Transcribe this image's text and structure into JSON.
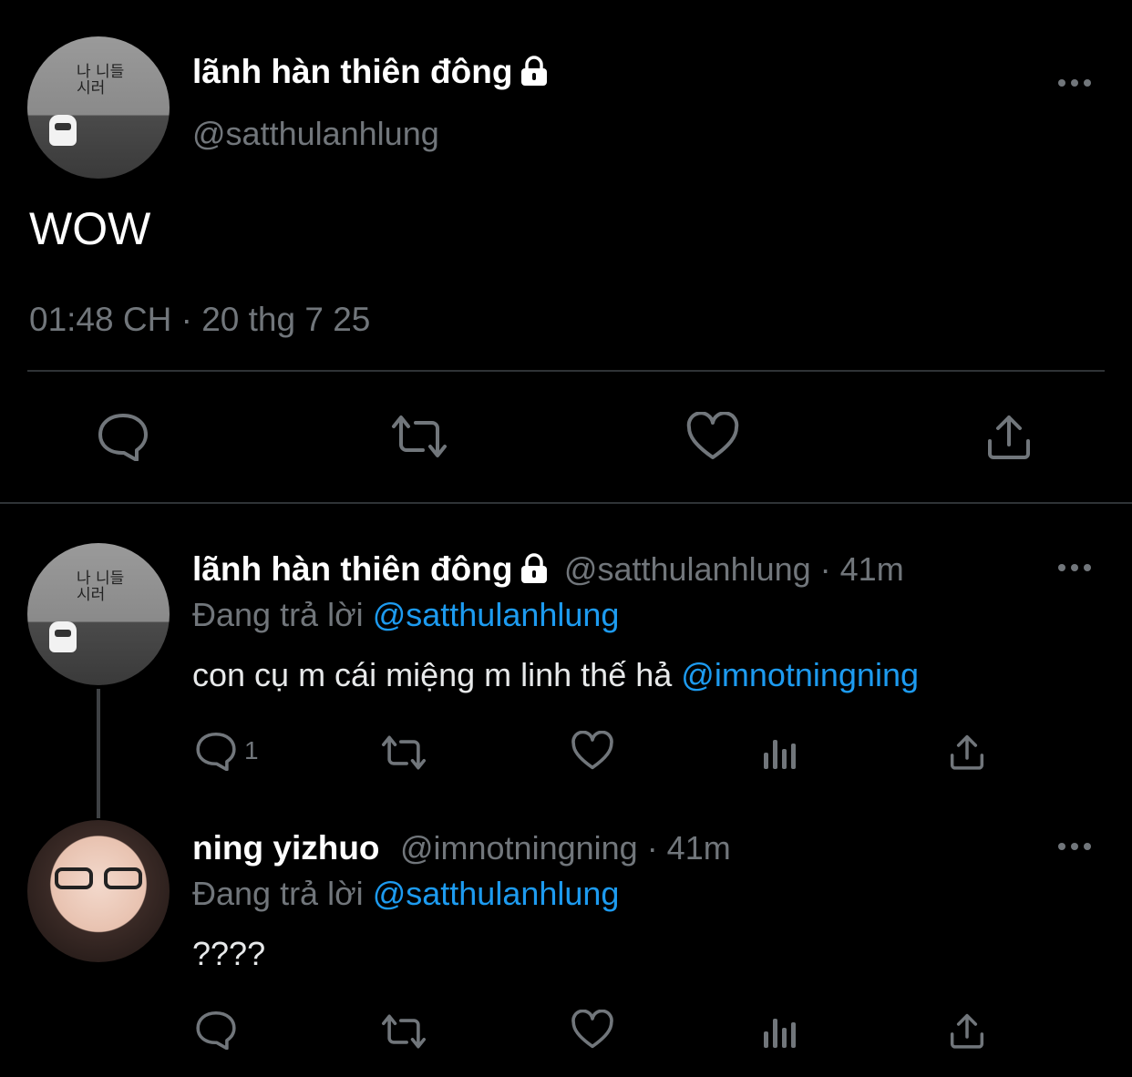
{
  "main_tweet": {
    "display_name": "lãnh hàn thiên đông",
    "handle": "@satthulanhlung",
    "text": "WOW",
    "timestamp": "01:48 CH · 20 thg 7 25"
  },
  "replies": [
    {
      "display_name": "lãnh hàn thiên đông",
      "handle_time": "@satthulanhlung · 41m",
      "replying_prefix": "Đang trả lời",
      "replying_to": "@satthulanhlung",
      "text": "con cụ m cái miệng m linh thế hả",
      "mention": "@imnotningning",
      "reply_count": "1"
    },
    {
      "display_name": "ning yizhuo",
      "handle_time": "@imnotningning · 41m",
      "replying_prefix": "Đang trả lời",
      "replying_to": "@satthulanhlung",
      "text": "????"
    }
  ],
  "avatar_graffiti": "나 니들\n시러",
  "colors": {
    "background": "#000000",
    "primary_text": "#e7e9ea",
    "secondary_text": "#71767b",
    "link": "#1d9bf0",
    "divider": "#2f3336"
  }
}
